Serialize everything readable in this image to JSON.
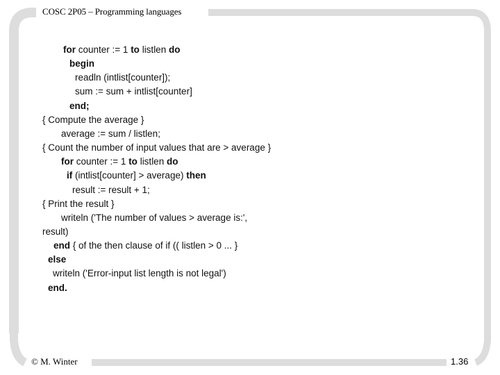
{
  "slide": {
    "header_title": "COSC 2P05 – Programming languages",
    "footer_author": "© M. Winter",
    "page_number": "1.36",
    "frame_color": "#DDDDDD"
  },
  "code_lines": [
    {
      "segments": [
        {
          "t": "for",
          "b": true
        },
        {
          "t": " counter := 1 ",
          "b": false
        },
        {
          "t": "to",
          "b": true
        },
        {
          "t": " listlen ",
          "b": false
        },
        {
          "t": "do",
          "b": true
        }
      ]
    },
    {
      "segments": [
        {
          "t": "begin",
          "b": true
        }
      ]
    },
    {
      "segments": [
        {
          "t": "readln (intlist[counter]);",
          "b": false
        }
      ]
    },
    {
      "segments": [
        {
          "t": "sum := sum + intlist[counter]",
          "b": false
        }
      ]
    },
    {
      "segments": [
        {
          "t": "end;",
          "b": true
        }
      ]
    },
    {
      "segments": [
        {
          "t": "{ Compute the average }",
          "b": false
        }
      ]
    },
    {
      "segments": [
        {
          "t": "average := sum / listlen;",
          "b": false
        }
      ]
    },
    {
      "segments": [
        {
          "t": "{ Count the number of input values that are > average }",
          "b": false
        }
      ]
    },
    {
      "segments": [
        {
          "t": "for",
          "b": true
        },
        {
          "t": " counter := 1 ",
          "b": false
        },
        {
          "t": "to",
          "b": true
        },
        {
          "t": " listlen ",
          "b": false
        },
        {
          "t": "do",
          "b": true
        }
      ]
    },
    {
      "segments": [
        {
          "t": "if",
          "b": true
        },
        {
          "t": " (intlist[counter] > average) ",
          "b": false
        },
        {
          "t": "then",
          "b": true
        }
      ]
    },
    {
      "segments": [
        {
          "t": "result := result + 1;",
          "b": false
        }
      ]
    },
    {
      "segments": [
        {
          "t": "{ Print the result }",
          "b": false
        }
      ]
    },
    {
      "segments": [
        {
          "t": "writeln ('The number of values > average is:',",
          "b": false
        }
      ]
    },
    {
      "segments": [
        {
          "t": "result)",
          "b": false
        }
      ]
    },
    {
      "segments": [
        {
          "t": "end",
          "b": true
        },
        {
          "t": " { of the then clause of if (( listlen > 0 ... }",
          "b": false
        }
      ]
    },
    {
      "segments": [
        {
          "t": "else",
          "b": true
        }
      ]
    },
    {
      "segments": [
        {
          "t": "writeln ('Error-input list length is not legal')",
          "b": false
        }
      ]
    },
    {
      "segments": [
        {
          "t": "end.",
          "b": true
        }
      ]
    }
  ]
}
